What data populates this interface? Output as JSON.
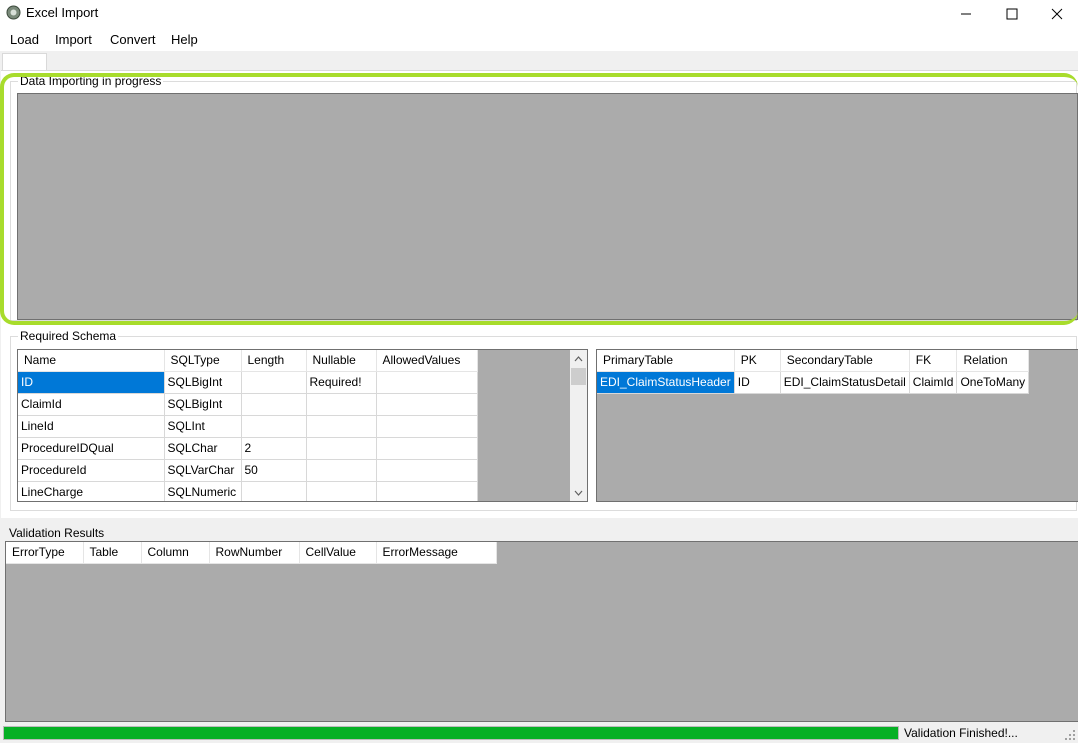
{
  "window": {
    "title": "Excel Import",
    "minimize_glyph": "—",
    "maximize_glyph": "☐",
    "close_glyph": "✕"
  },
  "menu": [
    "Load",
    "Import",
    "Convert",
    "Help"
  ],
  "import_group": {
    "label": "Data Importing in progress"
  },
  "schema_group": {
    "label": "Required Schema",
    "columns": [
      "Name",
      "SQLType",
      "Length",
      "Nullable",
      "AllowedValues"
    ],
    "rows": [
      [
        "ID",
        "SQLBigInt",
        "",
        "Required!",
        ""
      ],
      [
        "ClaimId",
        "SQLBigInt",
        "",
        "",
        ""
      ],
      [
        "LineId",
        "SQLInt",
        "",
        "",
        ""
      ],
      [
        "ProcedureIDQual",
        "SQLChar",
        "2",
        "",
        ""
      ],
      [
        "ProcedureId",
        "SQLVarChar",
        "50",
        "",
        ""
      ],
      [
        "LineCharge",
        "SQLNumeric",
        "",
        "",
        ""
      ]
    ],
    "selected_row": 0
  },
  "relations": {
    "columns": [
      "PrimaryTable",
      "PK",
      "SecondaryTable",
      "FK",
      "Relation"
    ],
    "rows": [
      [
        "EDI_ClaimStatusHeader",
        "ID",
        "EDI_ClaimStatusDetail",
        "ClaimId",
        "OneToMany"
      ]
    ],
    "selected_row": 0
  },
  "validation": {
    "label": "Validation Results",
    "columns": [
      "ErrorType",
      "Table",
      "Column",
      "RowNumber",
      "CellValue",
      "ErrorMessage"
    ]
  },
  "status": {
    "progress_percent": 100,
    "text": "Validation Finished!..."
  },
  "colors": {
    "highlight": "#a8dc2c",
    "selection": "#0078d7",
    "progress": "#06b025",
    "grid_background": "#ababab"
  },
  "icons": {
    "app": "app-icon",
    "scroll_up": "arrow-up-icon",
    "scroll_down": "arrow-down-icon",
    "grip": "resize-grip-icon"
  }
}
